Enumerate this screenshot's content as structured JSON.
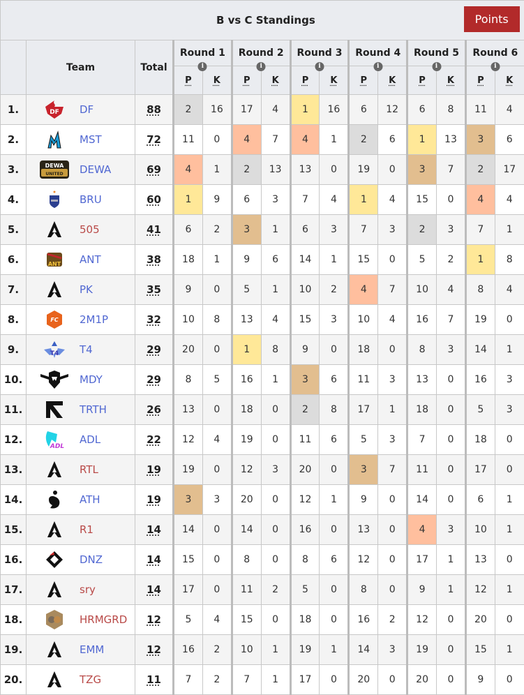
{
  "title": "B vs C Standings",
  "points_button": "Points",
  "headers": {
    "team": "Team",
    "total": "Total",
    "rounds": [
      "Round 1",
      "Round 2",
      "Round 3",
      "Round 4",
      "Round 5",
      "Round 6"
    ],
    "p": "P",
    "k": "K"
  },
  "colors": {
    "place_1": "#ffe898",
    "place_2": "#dcdcdc",
    "place_3": "#e2be8f",
    "place_4": "#ffbf9e",
    "points_button": "#b22a2a",
    "team_link": "#5168d2",
    "team_link_new": "#b94a48"
  },
  "rows": [
    {
      "rank": "1.",
      "team": "DF",
      "logo": "df-logo",
      "link": "blue",
      "total": "88",
      "p": [
        2,
        17,
        1,
        6,
        6,
        11
      ],
      "k": [
        16,
        4,
        16,
        12,
        8,
        4
      ]
    },
    {
      "rank": "2.",
      "team": "MST",
      "logo": "mst-logo",
      "link": "blue",
      "total": "72",
      "p": [
        11,
        4,
        4,
        2,
        1,
        3
      ],
      "k": [
        0,
        7,
        1,
        6,
        13,
        6
      ]
    },
    {
      "rank": "3.",
      "team": "DEWA",
      "logo": "dewa-logo",
      "link": "blue",
      "total": "69",
      "p": [
        4,
        2,
        13,
        19,
        3,
        2
      ],
      "k": [
        1,
        13,
        0,
        0,
        7,
        17
      ]
    },
    {
      "rank": "4.",
      "team": "BRU",
      "logo": "bru-logo",
      "link": "blue",
      "total": "60",
      "p": [
        1,
        6,
        7,
        1,
        15,
        4
      ],
      "k": [
        9,
        3,
        4,
        4,
        0,
        4
      ]
    },
    {
      "rank": "5.",
      "team": "505",
      "logo": "apex-logo",
      "link": "red",
      "total": "41",
      "p": [
        6,
        3,
        6,
        7,
        2,
        7
      ],
      "k": [
        2,
        1,
        3,
        3,
        3,
        1
      ]
    },
    {
      "rank": "6.",
      "team": "ANT",
      "logo": "ant-logo",
      "link": "blue",
      "total": "38",
      "p": [
        18,
        9,
        14,
        15,
        5,
        1
      ],
      "k": [
        1,
        6,
        1,
        0,
        2,
        8
      ]
    },
    {
      "rank": "7.",
      "team": "PK",
      "logo": "apex-logo",
      "link": "blue",
      "total": "35",
      "p": [
        9,
        5,
        10,
        4,
        10,
        8
      ],
      "k": [
        0,
        1,
        2,
        7,
        4,
        4
      ]
    },
    {
      "rank": "8.",
      "team": "2M1P",
      "logo": "fc-logo",
      "link": "blue",
      "total": "32",
      "p": [
        10,
        13,
        15,
        10,
        16,
        19
      ],
      "k": [
        8,
        4,
        3,
        4,
        7,
        0
      ]
    },
    {
      "rank": "9.",
      "team": "T4",
      "logo": "t4-logo",
      "link": "blue",
      "total": "29",
      "p": [
        20,
        1,
        9,
        18,
        8,
        14
      ],
      "k": [
        0,
        8,
        0,
        0,
        3,
        1
      ]
    },
    {
      "rank": "10.",
      "team": "MDY",
      "logo": "mdy-logo",
      "link": "blue",
      "total": "29",
      "p": [
        8,
        16,
        3,
        11,
        13,
        16
      ],
      "k": [
        5,
        1,
        6,
        3,
        0,
        3
      ]
    },
    {
      "rank": "11.",
      "team": "TRTH",
      "logo": "trth-logo",
      "link": "blue",
      "total": "26",
      "p": [
        13,
        18,
        2,
        17,
        18,
        5
      ],
      "k": [
        0,
        0,
        8,
        1,
        0,
        3
      ]
    },
    {
      "rank": "12.",
      "team": "ADL",
      "logo": "adl-logo",
      "link": "blue",
      "total": "22",
      "p": [
        12,
        19,
        11,
        5,
        7,
        18
      ],
      "k": [
        4,
        0,
        6,
        3,
        0,
        0
      ]
    },
    {
      "rank": "13.",
      "team": "RTL",
      "logo": "apex-logo",
      "link": "red",
      "total": "19",
      "p": [
        19,
        12,
        20,
        3,
        11,
        17
      ],
      "k": [
        0,
        3,
        0,
        7,
        0,
        0
      ]
    },
    {
      "rank": "14.",
      "team": "ATH",
      "logo": "ath-logo",
      "link": "blue",
      "total": "19",
      "p": [
        3,
        20,
        12,
        9,
        14,
        6
      ],
      "k": [
        3,
        0,
        1,
        0,
        0,
        1
      ]
    },
    {
      "rank": "15.",
      "team": "R1",
      "logo": "apex-logo",
      "link": "red",
      "total": "14",
      "p": [
        14,
        14,
        16,
        13,
        4,
        10
      ],
      "k": [
        0,
        0,
        0,
        0,
        3,
        1
      ]
    },
    {
      "rank": "16.",
      "team": "DNZ",
      "logo": "dnz-logo",
      "link": "blue",
      "total": "14",
      "p": [
        15,
        8,
        8,
        12,
        17,
        13
      ],
      "k": [
        0,
        0,
        6,
        0,
        1,
        0
      ]
    },
    {
      "rank": "17.",
      "team": "sry",
      "logo": "apex-logo",
      "link": "red",
      "total": "14",
      "p": [
        17,
        11,
        5,
        8,
        9,
        12
      ],
      "k": [
        0,
        2,
        0,
        0,
        1,
        1
      ]
    },
    {
      "rank": "18.",
      "team": "HRMGRD",
      "logo": "hrmgrd-logo",
      "link": "red",
      "total": "12",
      "p": [
        5,
        15,
        18,
        16,
        12,
        20
      ],
      "k": [
        4,
        0,
        0,
        2,
        0,
        0
      ]
    },
    {
      "rank": "19.",
      "team": "EMM",
      "logo": "apex-logo",
      "link": "blue",
      "total": "12",
      "p": [
        16,
        10,
        19,
        14,
        19,
        15
      ],
      "k": [
        2,
        1,
        1,
        3,
        0,
        1
      ]
    },
    {
      "rank": "20.",
      "team": "TZG",
      "logo": "apex-logo",
      "link": "red",
      "total": "11",
      "p": [
        7,
        7,
        17,
        20,
        20,
        9
      ],
      "k": [
        2,
        1,
        0,
        0,
        0,
        0
      ]
    }
  ]
}
